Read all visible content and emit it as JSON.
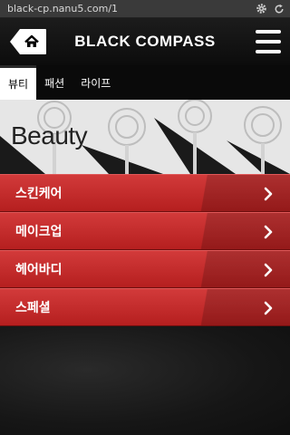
{
  "browser": {
    "url": "black-cp.nanu5.com/1",
    "icons": [
      "gear-icon",
      "refresh-icon"
    ]
  },
  "header": {
    "title": "BLACK COMPASS",
    "home_icon": "home-icon",
    "menu_icon": "hamburger-menu-icon"
  },
  "tabs": [
    {
      "label": "뷰티",
      "active": true
    },
    {
      "label": "패션",
      "active": false
    },
    {
      "label": "라이프",
      "active": false
    }
  ],
  "banner": {
    "title": "Beauty"
  },
  "categories": [
    {
      "label": "스킨케어"
    },
    {
      "label": "메이크업"
    },
    {
      "label": "헤어바디"
    },
    {
      "label": "스페셜"
    }
  ],
  "colors": {
    "accent_red": "#c42a2a",
    "header_bg": "#111111",
    "tab_active_bg": "#ffffff"
  }
}
